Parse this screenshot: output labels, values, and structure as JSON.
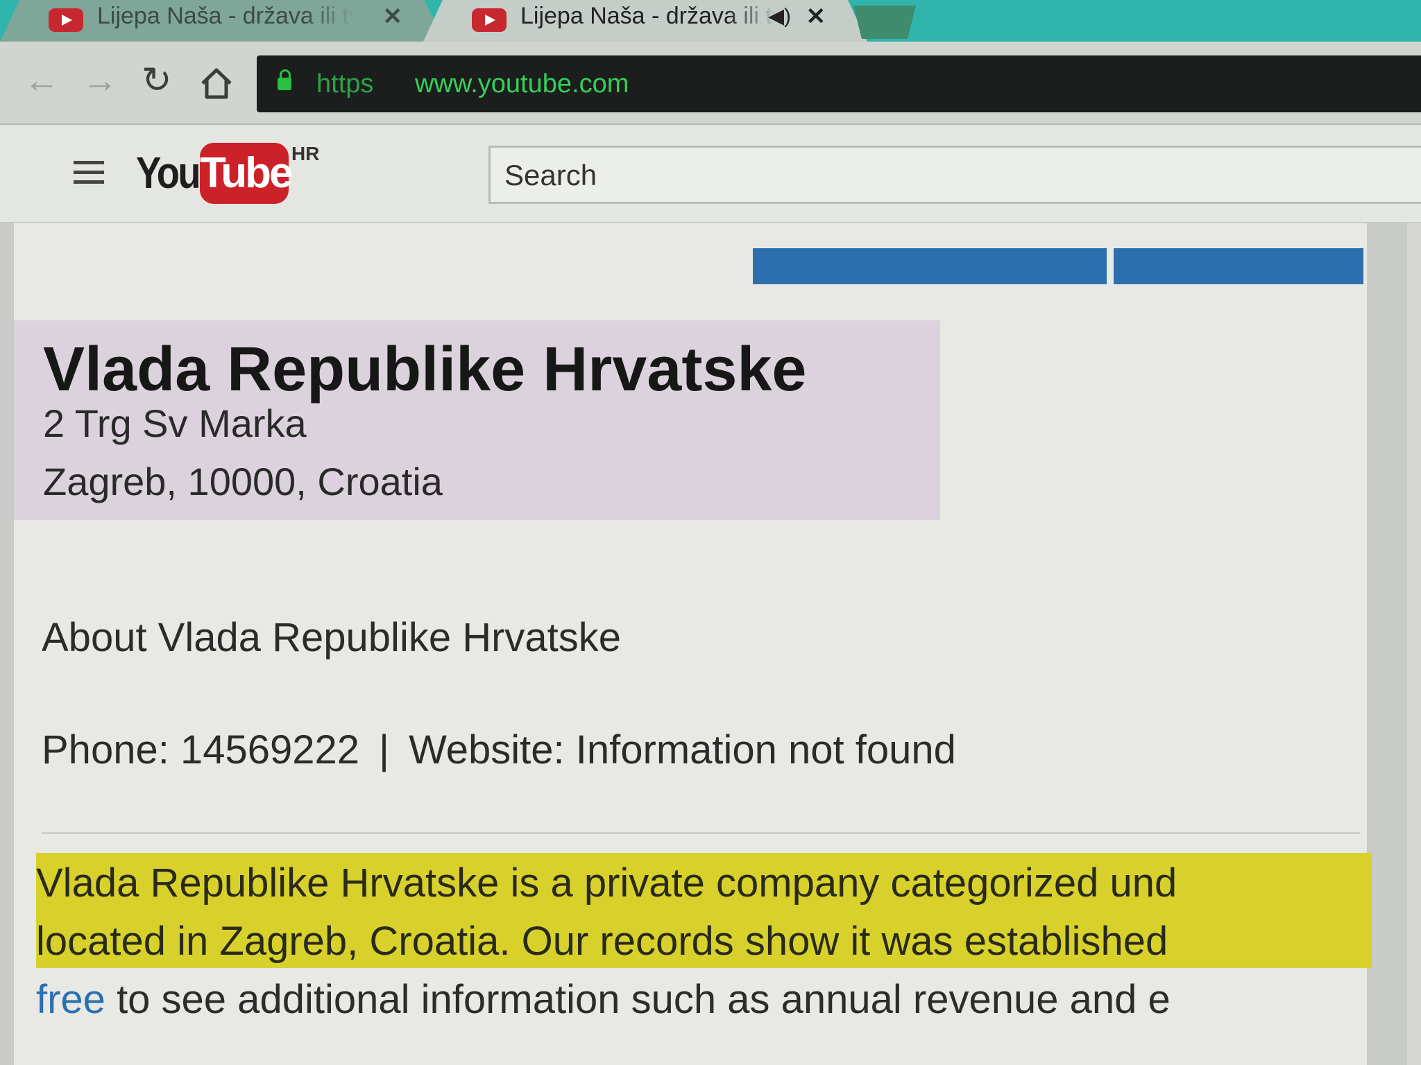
{
  "tabs": [
    {
      "title": "Lijepa Naša - država ili tv",
      "active": false,
      "audio": false
    },
    {
      "title": "Lijepa Naša - država ili tv",
      "active": true,
      "audio": true
    }
  ],
  "toolbar": {
    "url_scheme": "https",
    "url_host": "www.youtube.com",
    "icons": [
      "back-icon",
      "forward-icon",
      "reload-icon",
      "home-icon",
      "lock-icon"
    ]
  },
  "youtube": {
    "logo_you": "You",
    "logo_tube": "Tube",
    "country_code": "HR",
    "search_placeholder": "Search",
    "brand_red": "#cc2128"
  },
  "company": {
    "name": "Vlada Republike Hrvatske",
    "address_line1": "2 Trg Sv Marka",
    "address_line2": "Zagreb, 10000, Croatia",
    "about_heading": "About Vlada Republike Hrvatske",
    "phone_text": "Phone: 14569222",
    "separator": "|",
    "website_text": "Website: Information not found",
    "description_line1": "Vlada Republike Hrvatske is a private company categorized und",
    "description_line2": "located in Zagreb, Croatia. Our records show it was established",
    "description_line3_link": "free",
    "description_line3_rest": " to see additional information such as annual revenue and e"
  },
  "colors": {
    "tab_strip": "#2fb5ab",
    "highlight": "#d8d12c",
    "link": "#2b6fb0",
    "nav_blue": "#2c6fae"
  }
}
